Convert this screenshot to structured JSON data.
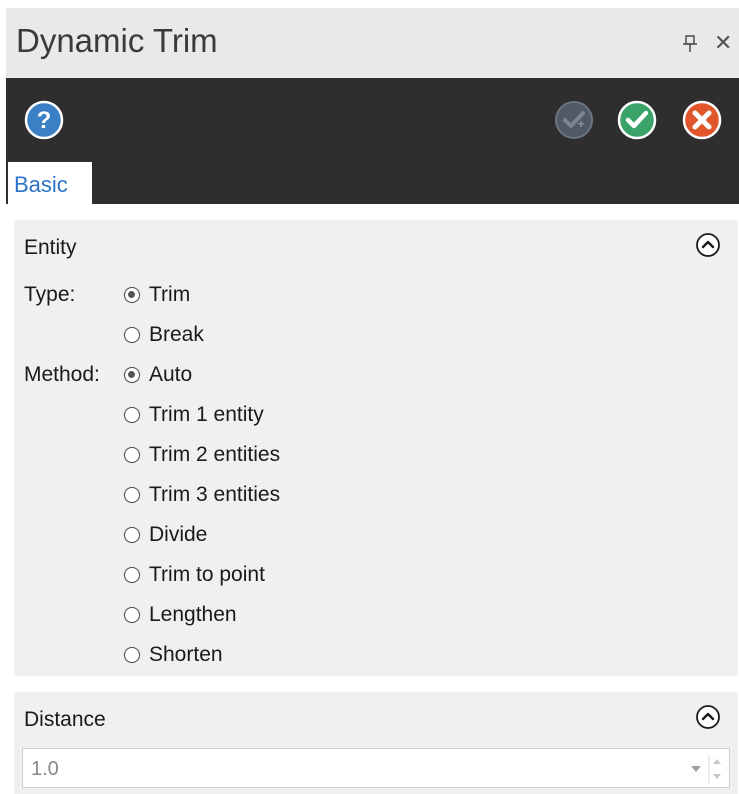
{
  "window": {
    "title": "Dynamic Trim"
  },
  "toolbar": {
    "help_icon": "help-icon",
    "ok_and_create_icon": "ok-and-create-new-icon",
    "ok_icon": "ok-icon",
    "cancel_icon": "cancel-icon"
  },
  "tabs": [
    {
      "label": "Basic",
      "active": true
    }
  ],
  "entity": {
    "section_title": "Entity",
    "type_label": "Type:",
    "type_options": [
      {
        "label": "Trim",
        "selected": true
      },
      {
        "label": "Break",
        "selected": false
      }
    ],
    "method_label": "Method:",
    "method_options": [
      {
        "label": "Auto",
        "selected": true
      },
      {
        "label": "Trim 1 entity",
        "selected": false
      },
      {
        "label": "Trim 2 entities",
        "selected": false
      },
      {
        "label": "Trim 3 entities",
        "selected": false
      },
      {
        "label": "Divide",
        "selected": false
      },
      {
        "label": "Trim to point",
        "selected": false
      },
      {
        "label": "Lengthen",
        "selected": false
      },
      {
        "label": "Shorten",
        "selected": false
      }
    ]
  },
  "distance": {
    "section_title": "Distance",
    "value": "1.0"
  },
  "colors": {
    "toolbar_bg": "#2e2e2e",
    "help_blue": "#3b7fc4",
    "ok_green": "#3aa36a",
    "cancel_orange": "#e0552a",
    "tab_text": "#2b74c7"
  }
}
